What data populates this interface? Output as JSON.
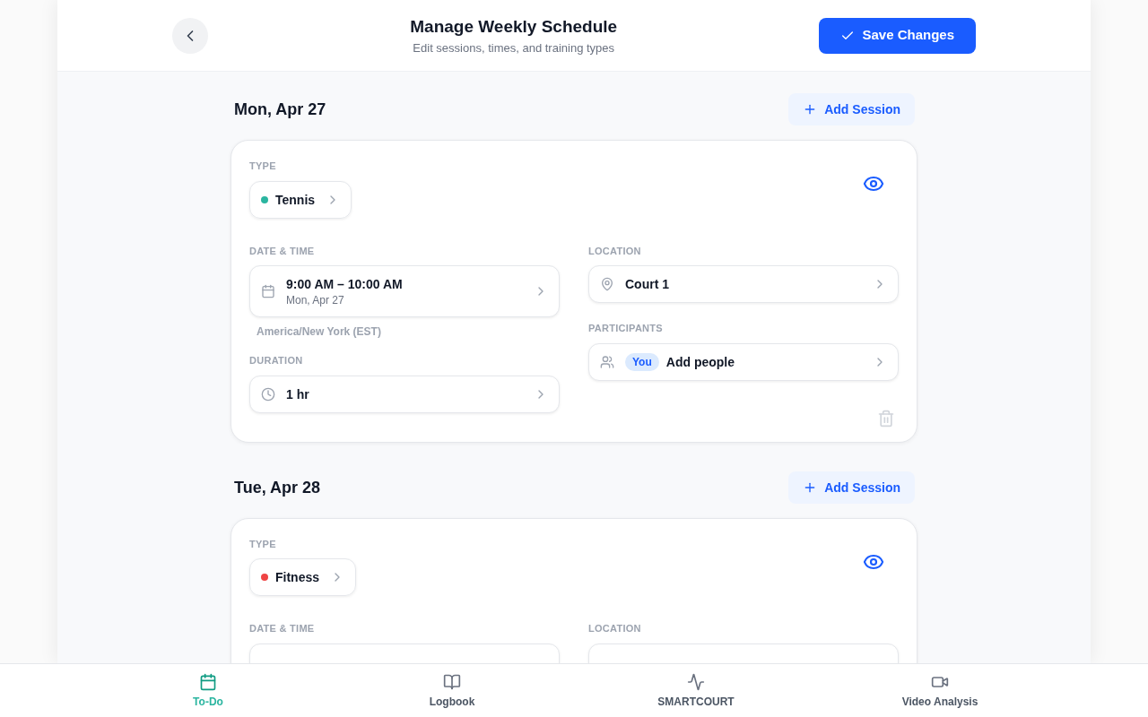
{
  "header": {
    "title": "Manage Weekly Schedule",
    "subtitle": "Edit sessions, times, and training types",
    "save_label": "Save Changes"
  },
  "days": [
    {
      "date": "Mon, Apr 27",
      "add_label": "Add Session",
      "session": {
        "type_label": "TYPE",
        "type": "Tennis",
        "color": "#2bb5a0",
        "visible": true,
        "datetime_label": "DATE & TIME",
        "time": "9:00 AM – 10:00 AM",
        "day": "Mon, Apr 27",
        "timezone": "America/New York (EST)",
        "duration_label": "DURATION",
        "duration": "1 hr",
        "location_label": "LOCATION",
        "location": "Court 1",
        "participants_label": "PARTICIPANTS",
        "participant_badge": "You",
        "participants_action": "Add people"
      }
    },
    {
      "date": "Tue, Apr 28",
      "add_label": "Add Session",
      "session": {
        "type_label": "TYPE",
        "type": "Fitness",
        "color": "#ef4444",
        "visible": true,
        "datetime_label": "DATE & TIME",
        "location_label": "LOCATION"
      }
    }
  ],
  "nav": [
    {
      "label": "To-Do",
      "selected": true
    },
    {
      "label": "Logbook",
      "selected": false
    },
    {
      "label": "SMARTCOURT",
      "selected": false
    },
    {
      "label": "Video Analysis",
      "selected": false
    }
  ]
}
